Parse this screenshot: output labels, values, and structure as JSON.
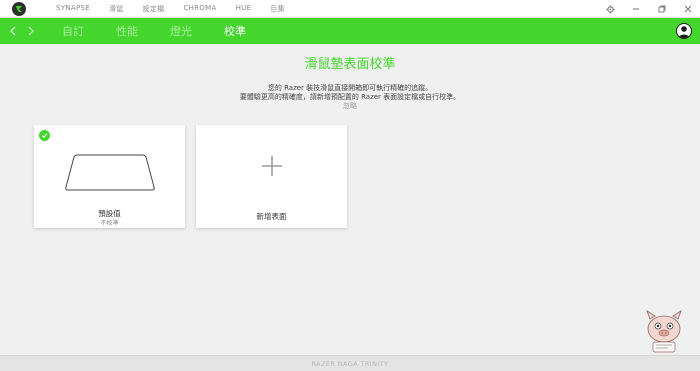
{
  "titlebar": {
    "nav": [
      "SYNAPSE",
      "滑鼠",
      "設定檔",
      "CHROMA",
      "HUE",
      "巨集"
    ]
  },
  "tabs": [
    {
      "label": "自訂",
      "active": false
    },
    {
      "label": "性能",
      "active": false
    },
    {
      "label": "燈光",
      "active": false
    },
    {
      "label": "校準",
      "active": true
    }
  ],
  "main": {
    "heading": "滑鼠墊表面校準",
    "desc_line1": "您的 Razer 裝技滑鼠直接開箱即可執行精確的追蹤。",
    "desc_line2": "要體驗更高的精確度，請新增預配置的 Razer 表面設定檔或自行校準。",
    "ignore": "忽略"
  },
  "cards": {
    "default": {
      "label": "預設值",
      "sub": "不校準",
      "selected": true
    },
    "add": {
      "label": "新增表面"
    }
  },
  "footer": {
    "device": "RAZER NAGA TRINITY"
  },
  "colors": {
    "accent": "#44d62c",
    "background": "#f0f0f0"
  },
  "icons": [
    "razer-logo-icon",
    "settings-icon",
    "minimize-icon",
    "maximize-icon",
    "close-icon",
    "back-arrow-icon",
    "forward-arrow-icon",
    "user-icon",
    "check-icon",
    "plus-icon"
  ]
}
